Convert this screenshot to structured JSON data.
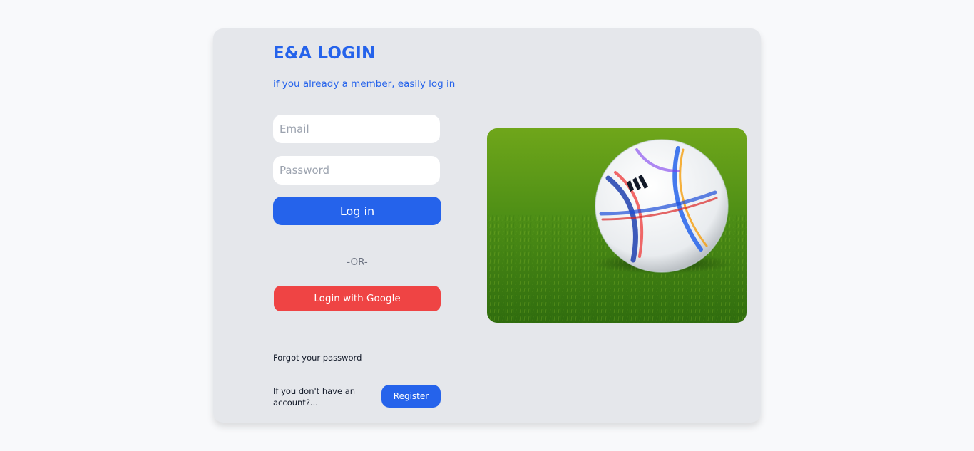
{
  "login": {
    "title": "E&A LOGIN",
    "subtitle": "if you already a member, easily log in",
    "email_placeholder": "Email",
    "password_placeholder": "Password",
    "login_label": "Log in",
    "or_label": "-OR-",
    "google_label": "Login with Google",
    "forgot_label": "Forgot your password",
    "no_account_label": "If you don't have an account?...",
    "register_label": "Register"
  },
  "image": {
    "icon": "soccer-ball-on-grass-photo"
  },
  "colors": {
    "accent": "#2563eb",
    "google": "#ef4444",
    "card": "#e5e7eb",
    "page": "#f8f9fb"
  }
}
